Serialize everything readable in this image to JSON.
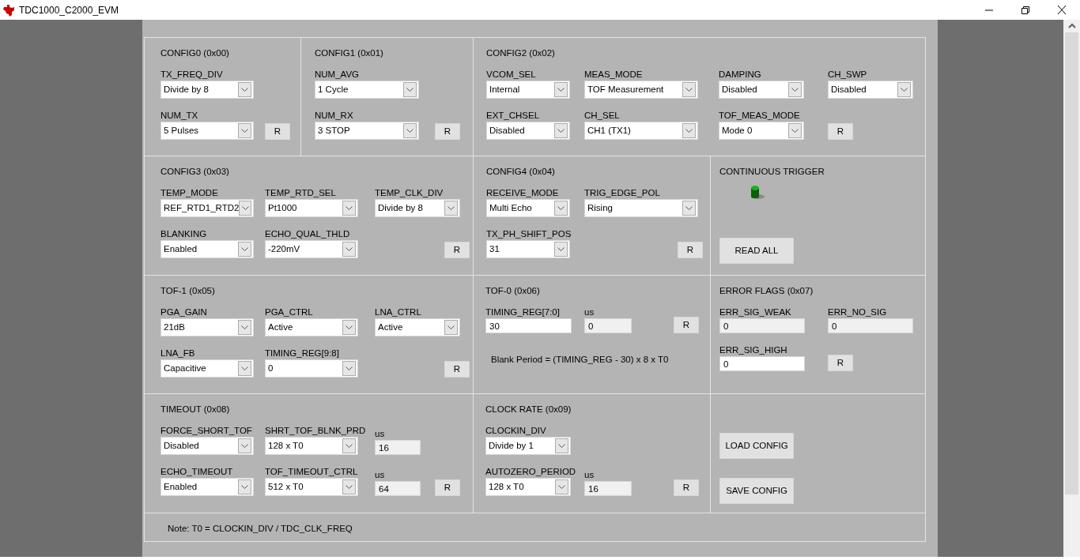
{
  "window": {
    "title": "TDC1000_C2000_EVM"
  },
  "panels": [
    {
      "title": "CONFIG0 (0x00)",
      "rows": [
        [
          {
            "kind": "combo",
            "label": "TX_FREQ_DIV",
            "value": "Divide by 8"
          }
        ],
        [
          {
            "kind": "combo",
            "label": "NUM_TX",
            "value": "5 Pulses"
          },
          {
            "kind": "button",
            "text": "R"
          }
        ]
      ]
    },
    {
      "title": "CONFIG1 (0x01)",
      "rows": [
        [
          {
            "kind": "combo",
            "label": "NUM_AVG",
            "value": "1 Cycle"
          }
        ],
        [
          {
            "kind": "combo",
            "label": "NUM_RX",
            "value": "3 STOP"
          },
          {
            "kind": "button",
            "text": "R"
          }
        ]
      ]
    },
    {
      "title": "CONFIG2 (0x02)",
      "rows": [
        [
          {
            "kind": "combo",
            "label": "VCOM_SEL",
            "value": "Internal"
          },
          {
            "kind": "combo",
            "label": "MEAS_MODE",
            "value": "TOF Measurement"
          },
          {
            "kind": "combo",
            "label": "DAMPING",
            "value": "Disabled"
          },
          {
            "kind": "combo",
            "label": "CH_SWP",
            "value": "Disabled"
          }
        ],
        [
          {
            "kind": "combo",
            "label": "EXT_CHSEL",
            "value": "Disabled"
          },
          {
            "kind": "combo",
            "label": "CH_SEL",
            "value": "CH1 (TX1)"
          },
          {
            "kind": "combo",
            "label": "TOF_MEAS_MODE",
            "value": "Mode 0"
          },
          {
            "kind": "button",
            "text": "R"
          }
        ]
      ]
    },
    {
      "title": "CONFIG3 (0x03)",
      "rows": [
        [
          {
            "kind": "combo",
            "label": "TEMP_MODE",
            "value": "REF_RTD1_RTD2"
          },
          {
            "kind": "combo",
            "label": "TEMP_RTD_SEL",
            "value": "Pt1000"
          },
          {
            "kind": "combo",
            "label": "TEMP_CLK_DIV",
            "value": "Divide by 8"
          }
        ],
        [
          {
            "kind": "combo",
            "label": "BLANKING",
            "value": "Enabled"
          },
          {
            "kind": "combo",
            "label": "ECHO_QUAL_THLD",
            "value": "-220mV"
          },
          {
            "kind": "button",
            "text": "R"
          }
        ]
      ]
    },
    {
      "title": "CONFIG4 (0x04)",
      "rows": [
        [
          {
            "kind": "combo",
            "label": "RECEIVE_MODE",
            "value": "Multi Echo"
          },
          {
            "kind": "combo",
            "label": "TRIG_EDGE_POL",
            "value": "Rising"
          }
        ],
        [
          {
            "kind": "combo",
            "label": "TX_PH_SHIFT_POS",
            "value": "31"
          },
          {
            "kind": "button",
            "text": "R"
          }
        ]
      ]
    },
    {
      "title": "CONTINUOUS TRIGGER",
      "rows": [
        [
          {
            "kind": "led",
            "on": true
          }
        ],
        [
          {
            "kind": "button",
            "text": "READ ALL"
          }
        ]
      ]
    },
    {
      "title": "TOF-1 (0x05)",
      "rows": [
        [
          {
            "kind": "combo",
            "label": "PGA_GAIN",
            "value": "21dB"
          },
          {
            "kind": "combo",
            "label": "PGA_CTRL",
            "value": "Active"
          },
          {
            "kind": "combo",
            "label": "LNA_CTRL",
            "value": "Active"
          }
        ],
        [
          {
            "kind": "combo",
            "label": "LNA_FB",
            "value": "Capacitive"
          },
          {
            "kind": "combo",
            "label": "TIMING_REG[9:8]",
            "value": "0"
          },
          {
            "kind": "button",
            "text": "R"
          }
        ]
      ]
    },
    {
      "title": "TOF-0 (0x06)",
      "rows": [
        [
          {
            "kind": "entry",
            "label": "TIMING_REG[7:0]",
            "value": "30"
          },
          {
            "kind": "readout",
            "label": "us",
            "value": "0"
          },
          {
            "kind": "button",
            "text": "R"
          }
        ],
        [
          {
            "kind": "text",
            "text": "Blank Period = (TIMING_REG - 30) x 8 x T0"
          }
        ]
      ]
    },
    {
      "title": "ERROR FLAGS (0x07)",
      "rows": [
        [
          {
            "kind": "readout",
            "label": "ERR_SIG_WEAK",
            "value": "0"
          },
          {
            "kind": "readout",
            "label": "ERR_NO_SIG",
            "value": "0"
          }
        ],
        [
          {
            "kind": "entry",
            "label": "ERR_SIG_HIGH",
            "value": "0"
          },
          {
            "kind": "button",
            "text": "R"
          }
        ]
      ]
    },
    {
      "title": "TIMEOUT (0x08)",
      "rows": [
        [
          {
            "kind": "combo",
            "label": "FORCE_SHORT_TOF",
            "value": "Disabled"
          },
          {
            "kind": "combo",
            "label": "SHRT_TOF_BLNK_PRD",
            "value": "128 x T0"
          },
          {
            "kind": "readout",
            "label": "us",
            "value": "16"
          }
        ],
        [
          {
            "kind": "combo",
            "label": "ECHO_TIMEOUT",
            "value": "Enabled"
          },
          {
            "kind": "combo",
            "label": "TOF_TIMEOUT_CTRL",
            "value": "512 x T0"
          },
          {
            "kind": "readout",
            "label": "us",
            "value": "64"
          },
          {
            "kind": "button",
            "text": "R"
          }
        ]
      ]
    },
    {
      "title": "CLOCK RATE (0x09)",
      "rows": [
        [
          {
            "kind": "combo",
            "label": "CLOCKIN_DIV",
            "value": "Divide by 1"
          }
        ],
        [
          {
            "kind": "combo",
            "label": "AUTOZERO_PERIOD",
            "value": "128 x T0"
          },
          {
            "kind": "readout",
            "label": "us",
            "value": "16"
          },
          {
            "kind": "button",
            "text": "R"
          }
        ]
      ]
    },
    {
      "rows": [
        [
          {
            "kind": "button",
            "text": "LOAD CONFIG"
          }
        ],
        [
          {
            "kind": "button",
            "text": "SAVE CONFIG"
          }
        ]
      ]
    },
    {
      "rows": [
        [
          {
            "kind": "text",
            "text": "Note: T0 = CLOCKIN_DIV / TDC_CLK_FREQ"
          }
        ]
      ]
    }
  ]
}
